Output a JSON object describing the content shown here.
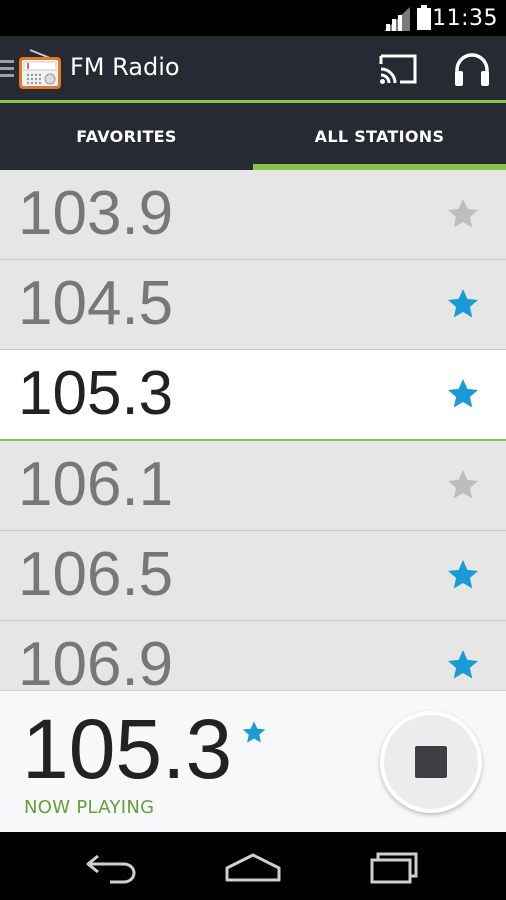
{
  "status_bar": {
    "time": "11:35"
  },
  "app": {
    "title": "FM Radio"
  },
  "tabs": [
    {
      "label": "FAVORITES",
      "active": false
    },
    {
      "label": "ALL STATIONS",
      "active": true
    }
  ],
  "stations": [
    {
      "frequency": "103.9",
      "favorite": false,
      "selected": false
    },
    {
      "frequency": "104.5",
      "favorite": true,
      "selected": false
    },
    {
      "frequency": "105.3",
      "favorite": true,
      "selected": true
    },
    {
      "frequency": "106.1",
      "favorite": false,
      "selected": false
    },
    {
      "frequency": "106.5",
      "favorite": true,
      "selected": false
    },
    {
      "frequency": "106.9",
      "favorite": true,
      "selected": false
    }
  ],
  "now_playing": {
    "frequency": "105.3",
    "favorite": true,
    "label": "NOW PLAYING"
  },
  "colors": {
    "accent_green": "#8bc34a",
    "now_playing_green": "#689f38",
    "star_blue": "#1a9bd7",
    "star_gray": "#bdbdbd",
    "bar_dark": "#252a33"
  }
}
